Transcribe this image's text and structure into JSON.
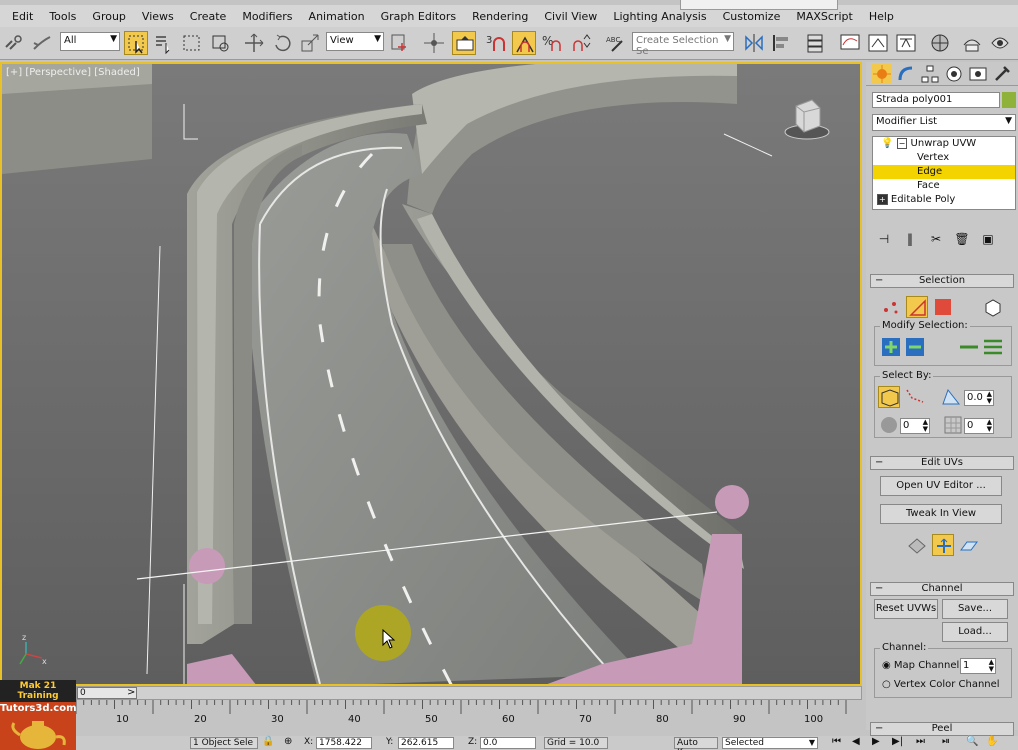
{
  "menu": [
    "Edit",
    "Tools",
    "Group",
    "Views",
    "Create",
    "Modifiers",
    "Animation",
    "Graph Editors",
    "Rendering",
    "Civil View",
    "Lighting Analysis",
    "Customize",
    "MAXScript",
    "Help"
  ],
  "toolbar": {
    "selection_filter": "All",
    "ref_coord": "View",
    "named_selection_placeholder": "Create Selection Se"
  },
  "viewport": {
    "label": "[+] [Perspective] [Shaded]"
  },
  "command_panel": {
    "object_name": "Strada poly001",
    "modifier_list": "Modifier List",
    "stack": [
      {
        "label": "Unwrap UVW",
        "level": 0
      },
      {
        "label": "Vertex",
        "level": 1
      },
      {
        "label": "Edge",
        "level": 1,
        "selected": true
      },
      {
        "label": "Face",
        "level": 1
      },
      {
        "label": "Editable Poly",
        "level": 0
      }
    ],
    "selection_rollout": "Selection",
    "modify_selection": "Modify Selection:",
    "select_by": "Select By:",
    "angle_value": "0.0",
    "spin1_value": "0",
    "spin2_value": "0",
    "edit_uvs_rollout": "Edit UVs",
    "open_uv_editor": "Open UV Editor ...",
    "tweak_in_view": "Tweak In View",
    "channel_rollout": "Channel",
    "reset_uvws": "Reset UVWs",
    "save": "Save...",
    "load": "Load...",
    "channel_label": "Channel:",
    "map_channel_label": "Map Channel:",
    "map_channel_value": "1",
    "vertex_color_channel": "Vertex Color Channel",
    "peel_rollout": "Peel"
  },
  "timeline": {
    "frame_label": "0",
    "ticks": [
      "10",
      "20",
      "30",
      "40",
      "50",
      "60",
      "70",
      "80",
      "90",
      "100"
    ]
  },
  "status": {
    "selected_count": "1 Object Sele",
    "x_label": "X:",
    "x_value": "1758.422",
    "y_label": "Y:",
    "y_value": "262.615",
    "z_label": "Z:",
    "z_value": "0.0",
    "grid": "Grid = 10.0",
    "auto_key": "Auto Key",
    "key_mode": "Selected"
  },
  "logo": {
    "line1": "Mak 21 Training",
    "line2": "Tutors3d.com"
  },
  "colors": {
    "accent": "#f2c94c",
    "selection_highlight": "#f3d300",
    "uv_edge_pink": "#c79ab8"
  }
}
